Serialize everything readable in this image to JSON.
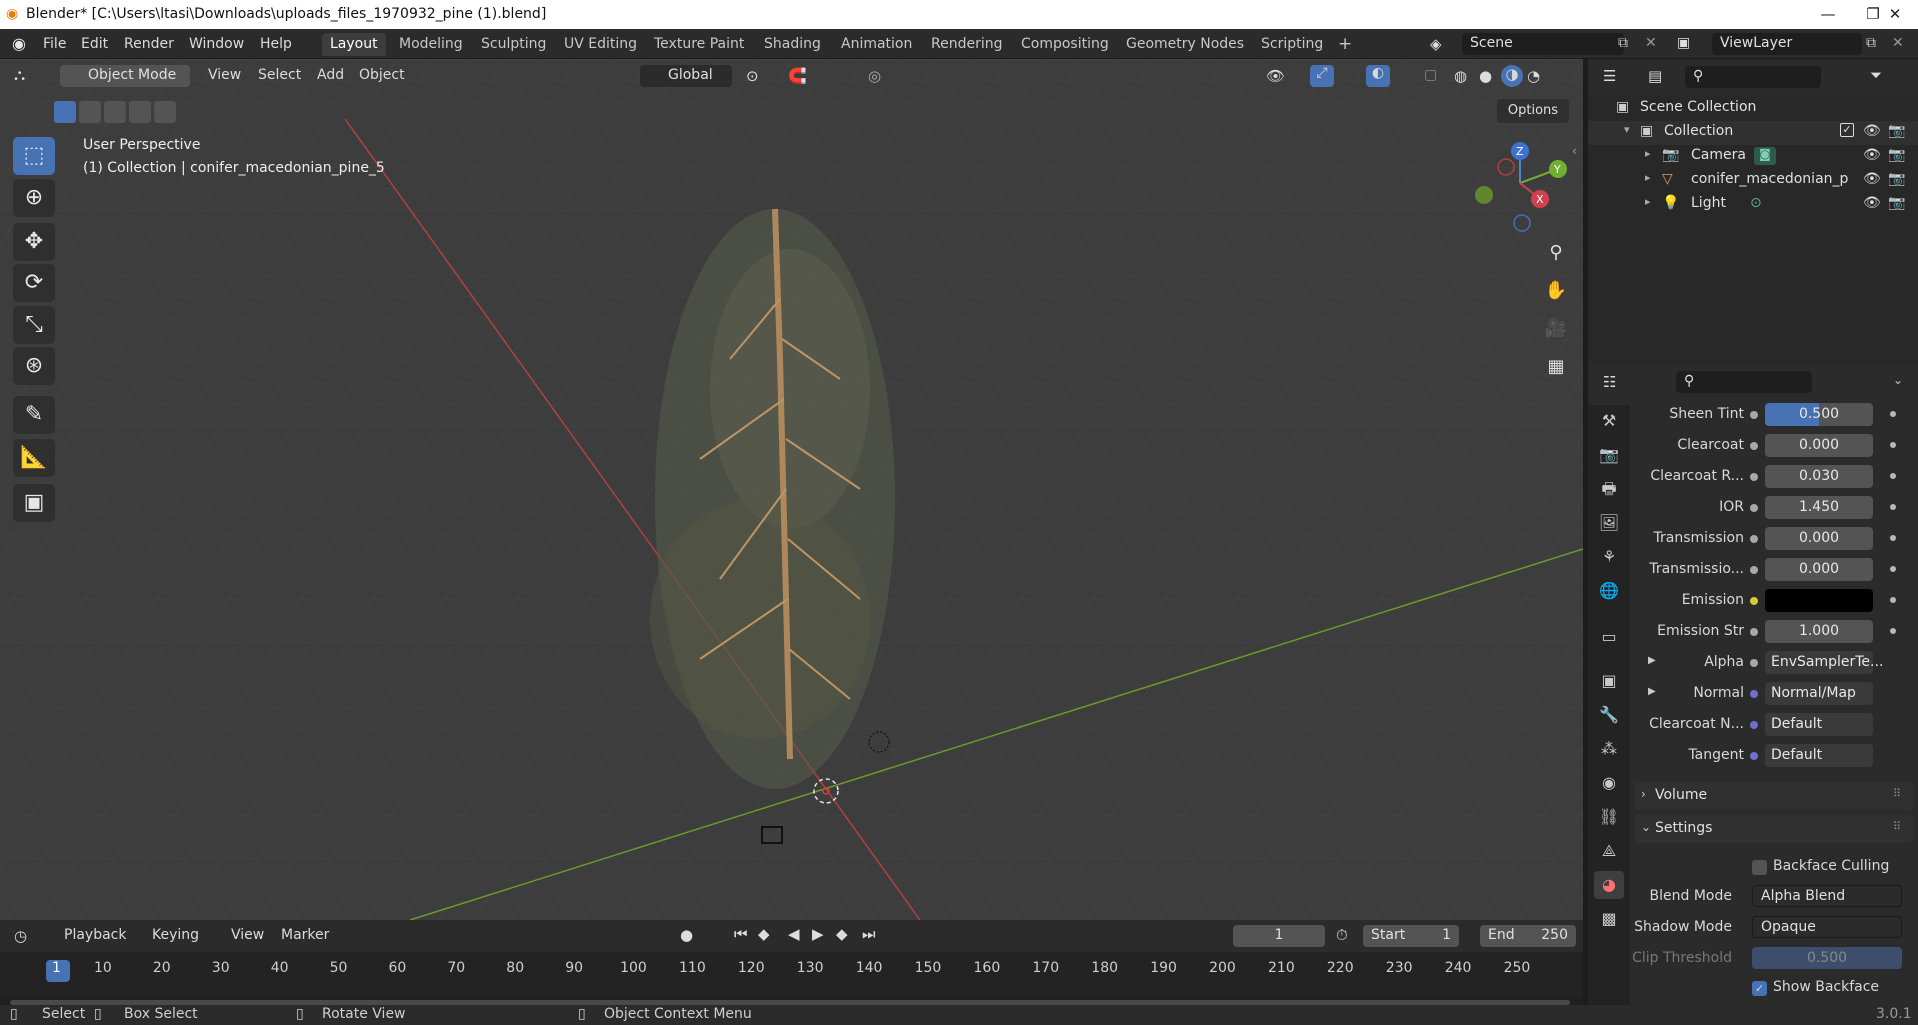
{
  "window": {
    "title": "Blender* [C:\\Users\\ltasi\\Downloads\\uploads_files_1970932_pine (1).blend]",
    "minimize": "—",
    "maximize": "❐",
    "close": "✕"
  },
  "menu": [
    "File",
    "Edit",
    "Render",
    "Window",
    "Help"
  ],
  "workspaces": [
    "Layout",
    "Modeling",
    "Sculpting",
    "UV Editing",
    "Texture Paint",
    "Shading",
    "Animation",
    "Rendering",
    "Compositing",
    "Geometry Nodes",
    "Scripting"
  ],
  "active_workspace": "Layout",
  "add_workspace": "+",
  "scene": {
    "name": "Scene",
    "view_layer": "ViewLayer"
  },
  "viewport_header": {
    "mode": "Object Mode",
    "menus": [
      "View",
      "Select",
      "Add",
      "Object"
    ],
    "orientation": "Global",
    "options": "Options"
  },
  "viewport": {
    "perspective": "User Perspective",
    "collection_info": "(1) Collection | conifer_macedonian_pine_5",
    "gizmo": {
      "z": "Z",
      "y": "Y",
      "x": "X"
    }
  },
  "outliner": {
    "root": "Scene Collection",
    "collection": "Collection",
    "items": [
      {
        "name": "Camera",
        "icon": "camera-icon",
        "color": "#d08a5a"
      },
      {
        "name": "conifer_macedonian_p",
        "icon": "mesh-icon",
        "color": "#e09a60"
      },
      {
        "name": "Light",
        "icon": "light-icon",
        "color": "#e09a60"
      }
    ]
  },
  "properties": {
    "rows": [
      {
        "label": "Sheen Tint",
        "value": "0.500",
        "slider": true
      },
      {
        "label": "Clearcoat",
        "value": "0.000"
      },
      {
        "label": "Clearcoat R...",
        "value": "0.030"
      },
      {
        "label": "IOR",
        "value": "1.450"
      },
      {
        "label": "Transmission",
        "value": "0.000"
      },
      {
        "label": "Transmissio...",
        "value": "0.000"
      },
      {
        "label": "Emission",
        "value": "",
        "color": true
      },
      {
        "label": "Emission Str",
        "value": "1.000"
      },
      {
        "label": "Alpha",
        "value": "EnvSamplerTe...",
        "link": true
      },
      {
        "label": "Normal",
        "value": "Normal/Map",
        "link": true
      },
      {
        "label": "Clearcoat N...",
        "value": "Default",
        "link": true
      },
      {
        "label": "Tangent",
        "value": "Default",
        "link": true
      }
    ],
    "volume": "Volume",
    "settings": "Settings",
    "backface_culling": "Backface Culling",
    "blend_mode_label": "Blend Mode",
    "blend_mode": "Alpha Blend",
    "shadow_mode_label": "Shadow Mode",
    "shadow_mode": "Opaque",
    "clip_threshold_label": "Clip Threshold",
    "clip_threshold": "0.500",
    "show_backface": "Show Backface",
    "version": "3.0.1"
  },
  "timeline": {
    "menus": [
      "Playback",
      "Keying",
      "View",
      "Marker"
    ],
    "current_frame": "1",
    "start_label": "Start",
    "start": "1",
    "end_label": "End",
    "end": "250",
    "ruler": [
      "1",
      "10",
      "20",
      "30",
      "40",
      "50",
      "60",
      "70",
      "80",
      "90",
      "100",
      "110",
      "120",
      "130",
      "140",
      "150",
      "160",
      "170",
      "180",
      "190",
      "200",
      "210",
      "220",
      "230",
      "240",
      "250"
    ]
  },
  "statusbar": {
    "select": "Select",
    "box_select": "Box Select",
    "rotate_view": "Rotate View",
    "context_menu": "Object Context Menu"
  }
}
